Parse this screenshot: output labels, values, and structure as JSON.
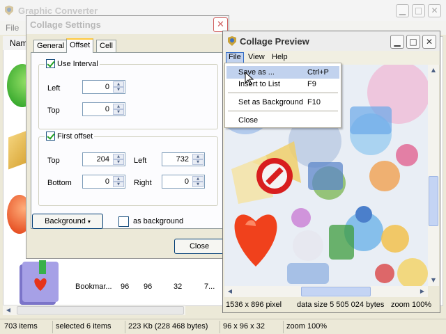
{
  "main_window": {
    "title": "Graphic Converter",
    "menu_file": "File",
    "list_header": "Nam",
    "thumb_row": {
      "name": "Bookmar...",
      "col1": "96",
      "col2": "96",
      "col3": "32",
      "col4": "7..."
    },
    "status": {
      "items": "703 items",
      "selected": "selected 6 items",
      "size": "223 Kb  (228 468 bytes)",
      "dims": "96 x 96 x 32",
      "zoom": "zoom 100%"
    }
  },
  "settings_dialog": {
    "title": "Collage Settings",
    "tabs": [
      "General",
      "Offset",
      "Cell"
    ],
    "active_tab": "Offset",
    "interval": {
      "label": "Use Interval",
      "checked": true,
      "left_label": "Left",
      "left_value": "0",
      "top_label": "Top",
      "top_value": "0"
    },
    "first_offset": {
      "label": "First offset",
      "checked": true,
      "top_label": "Top",
      "top_value": "204",
      "left_label": "Left",
      "left_value": "732",
      "bottom_label": "Bottom",
      "bottom_value": "0",
      "right_label": "Right",
      "right_value": "0"
    },
    "background_button": "Background",
    "as_background_label": "as background",
    "as_background_checked": false,
    "close_button": "Close"
  },
  "preview_window": {
    "title": "Collage Preview",
    "menu": [
      "File",
      "View",
      "Help"
    ],
    "file_menu": [
      {
        "label": "Save as ...",
        "shortcut": "Ctrl+P",
        "highlighted": true
      },
      {
        "label": "Insert to List",
        "shortcut": "F9"
      },
      {
        "label": "Set as Background",
        "shortcut": "F10"
      },
      {
        "label": "Close",
        "shortcut": ""
      }
    ],
    "status": {
      "size": "1536 x 896 pixel",
      "data_size": "data size 5 505 024 bytes",
      "zoom": "zoom 100%"
    }
  },
  "colors": {
    "xp_face": "#ece9d8",
    "menu_highlight": "#c1d2ee",
    "checkmark": "#21a121",
    "tab_accent": "#ffc83c"
  }
}
